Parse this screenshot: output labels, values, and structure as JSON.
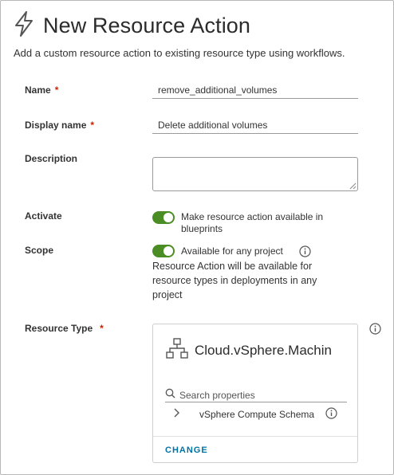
{
  "header": {
    "icon": "lightning-bolt-icon",
    "title": "New Resource Action",
    "subtitle": "Add a custom resource action to existing resource type using workflows."
  },
  "form": {
    "name": {
      "label": "Name",
      "required_mark": "*",
      "value": "remove_additional_volumes"
    },
    "display_name": {
      "label": "Display name",
      "required_mark": "*",
      "value": "Delete additional volumes"
    },
    "description": {
      "label": "Description",
      "value": ""
    },
    "activate": {
      "label": "Activate",
      "toggle_on": true,
      "text_line1": "Make resource action available in",
      "text_line2": "blueprints"
    },
    "scope": {
      "label": "Scope",
      "toggle_on": true,
      "text": "Available for any project",
      "help_line1": "Resource Action will be available for",
      "help_line2": "resource types in deployments in any",
      "help_line3": "project"
    },
    "resource_type": {
      "label": "Resource Type",
      "required_mark": "*",
      "card_icon": "hierarchy-icon",
      "card_title": "Cloud.vSphere.Machin",
      "search_placeholder": "Search properties",
      "tree_item": "vSphere Compute Schema",
      "change_label": "CHANGE"
    }
  },
  "colors": {
    "accent": "#0072a3",
    "toggle_on": "#4a8d24",
    "required": "#c92100"
  }
}
